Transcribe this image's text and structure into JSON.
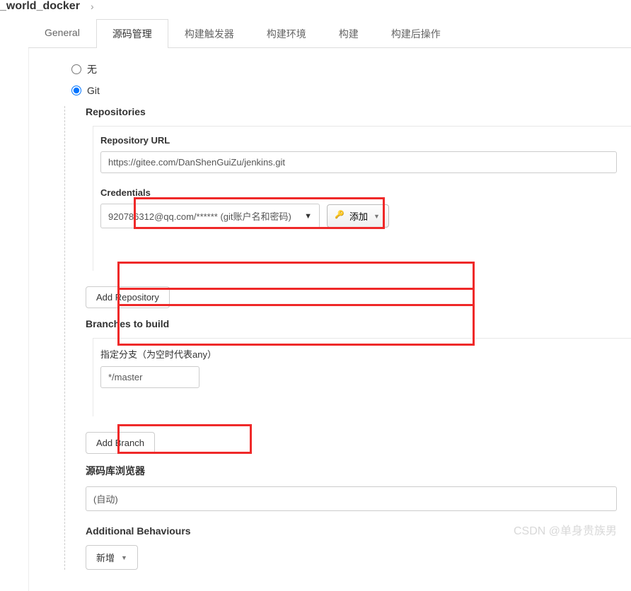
{
  "breadcrumb": {
    "title": "_world_docker"
  },
  "tabs": {
    "general": "General",
    "scm": "源码管理",
    "triggers": "构建触发器",
    "env": "构建环境",
    "build": "构建",
    "post": "构建后操作"
  },
  "scm": {
    "none_label": "无",
    "git_label": "Git",
    "selected": "git",
    "repositories_title": "Repositories",
    "repo_url_label": "Repository URL",
    "repo_url_value": "https://gitee.com/DanShenGuiZu/jenkins.git",
    "credentials_label": "Credentials",
    "credentials_value": "920786312@qq.com/****** (git账户名和密码)",
    "add_credential_label": "添加",
    "add_repository_label": "Add Repository",
    "branches_title": "Branches to build",
    "branch_spec_label": "指定分支（为空时代表any）",
    "branch_spec_value": "*/master",
    "add_branch_label": "Add Branch",
    "repo_browser_label": "源码库浏览器",
    "repo_browser_value": "(自动)",
    "additional_behaviours_label": "Additional Behaviours",
    "add_behaviour_label": "新增"
  },
  "watermark": "CSDN @单身贵族男"
}
